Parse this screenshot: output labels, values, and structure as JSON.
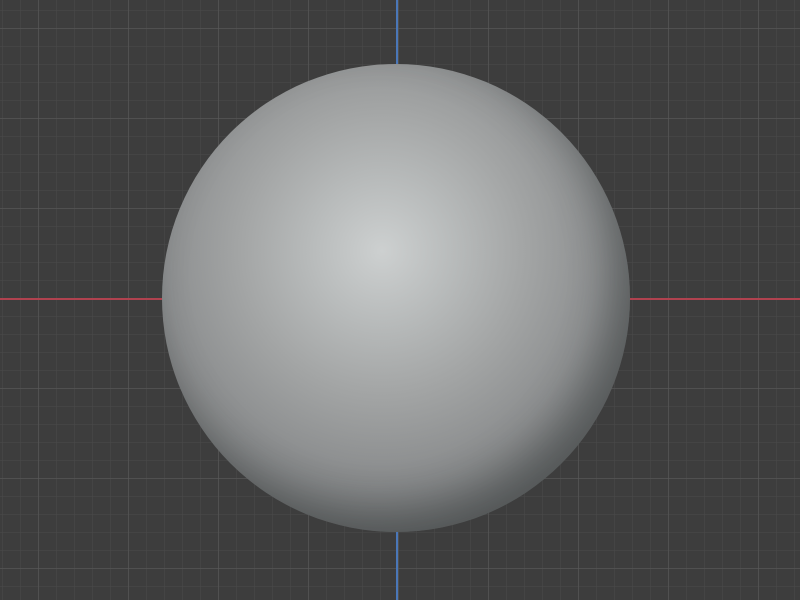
{
  "viewport": {
    "background_color": "#3d3d3d",
    "grid_color": "#5a5a5a",
    "x_axis_color": "#b0424f",
    "y_axis_color": "#4a77b8"
  },
  "object": {
    "shape": "sphere",
    "base_color": "#a3a5a5",
    "highlight_color": "#cdd0d0",
    "shadow_color": "#444647"
  }
}
